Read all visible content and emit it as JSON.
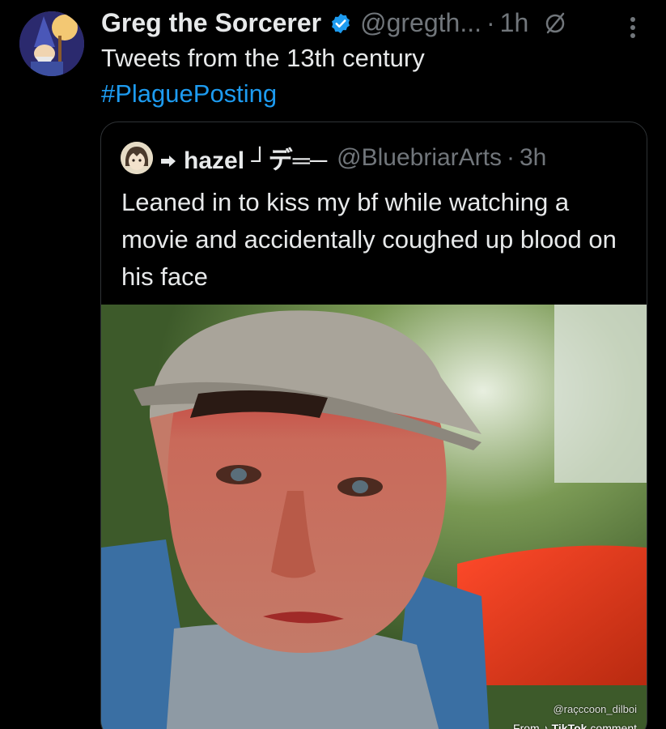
{
  "tweet": {
    "display_name": "Greg the Sorcerer",
    "handle": "@gregth...",
    "separator": "·",
    "time": "1h",
    "text": "Tweets from the 13th century",
    "hashtag": "#PlaguePosting",
    "verified_icon": "verified-badge-icon",
    "muted_icon": "muted-icon",
    "more_icon": "more-options-icon",
    "accent_color": "#1d9bf0"
  },
  "quoted_tweet": {
    "display_name": "hazel ┘デ═─",
    "handle": "@BluebriarArts",
    "separator": "·",
    "time": "3h",
    "text": "Leaned in to kiss my bf while watching a movie and accidentally coughed up blood on his face",
    "media": {
      "watermark_user": "@raçccoon_dilboi",
      "watermark_from": "From",
      "watermark_brand": "TikTok",
      "watermark_suffix": "comment"
    }
  }
}
